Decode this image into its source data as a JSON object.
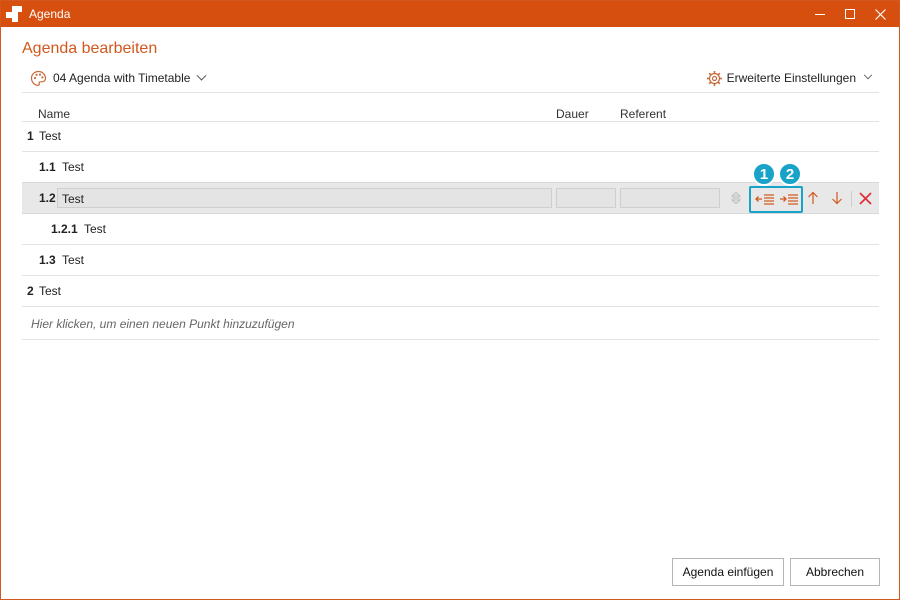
{
  "window": {
    "title": "Agenda"
  },
  "dialog": {
    "heading": "Agenda bearbeiten",
    "template": "04 Agenda with Timetable",
    "settings_label": "Erweiterte Einstellungen"
  },
  "columns": {
    "name": "Name",
    "duration": "Dauer",
    "speaker": "Referent"
  },
  "rows": [
    {
      "num": "1",
      "text": "Test"
    },
    {
      "num": "1.1",
      "text": "Test"
    },
    {
      "num": "1.2",
      "text": "Test"
    },
    {
      "num": "1.2.1",
      "text": "Test"
    },
    {
      "num": "1.3",
      "text": "Test"
    },
    {
      "num": "2",
      "text": "Test"
    }
  ],
  "add_hint": "Hier klicken, um einen neuen Punkt hinzuzufügen",
  "callouts": {
    "one": "1",
    "two": "2"
  },
  "buttons": {
    "insert": "Agenda einfügen",
    "cancel": "Abbrechen"
  },
  "colors": {
    "accent": "#d2581e",
    "titlebar": "#d64f0e",
    "callout": "#1aa3c9",
    "delete": "#e0303a"
  }
}
